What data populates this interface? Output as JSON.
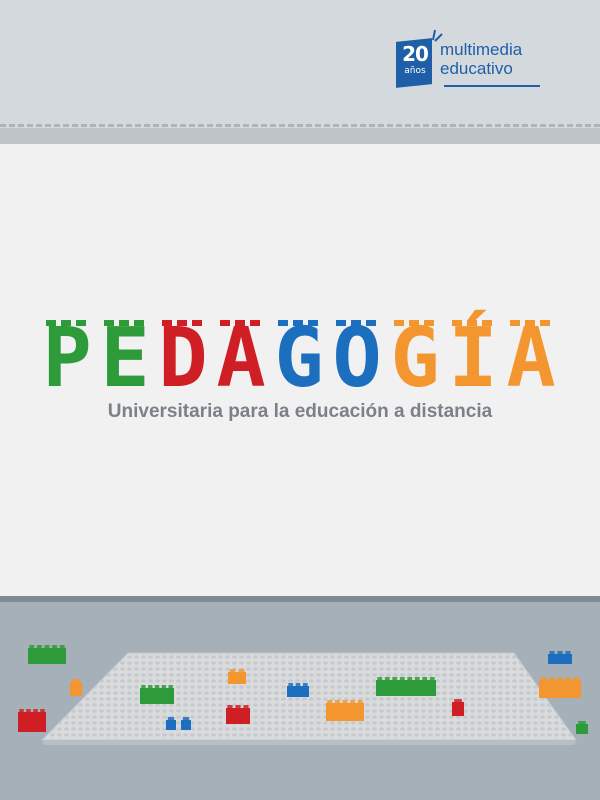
{
  "logo": {
    "number": "20",
    "anos": "años",
    "line1": "multimedia",
    "line2": "educativo"
  },
  "title": {
    "letters": [
      {
        "ch": "P",
        "color": "#2e9b3a"
      },
      {
        "ch": "E",
        "color": "#2e9b3a"
      },
      {
        "ch": "D",
        "color": "#cf1f25"
      },
      {
        "ch": "A",
        "color": "#cf1f25"
      },
      {
        "ch": "G",
        "color": "#1c6fbf"
      },
      {
        "ch": "O",
        "color": "#1c6fbf"
      },
      {
        "ch": "G",
        "color": "#f4962f"
      },
      {
        "ch": "Í",
        "color": "#f4962f"
      },
      {
        "ch": "A",
        "color": "#f4962f"
      }
    ]
  },
  "subtitle": "Universitaria para la educación a distancia",
  "colors": {
    "green": "#2e9b3a",
    "red": "#cf1f25",
    "blue": "#1c6fbf",
    "orange": "#f4962f",
    "brand_blue": "#1f5fa8"
  }
}
